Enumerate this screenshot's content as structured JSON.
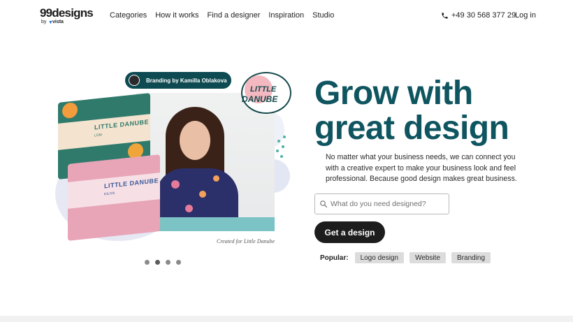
{
  "header": {
    "logo_text": "99designs",
    "logo_by": "by",
    "logo_vista": "vista",
    "nav": [
      "Categories",
      "How it works",
      "Find a designer",
      "Inspiration",
      "Studio"
    ],
    "phone": "+49 30 568 377 29",
    "login": "Log in"
  },
  "hero_visual": {
    "badge_text": "Branding by Kamilla Oblakova",
    "brand_line1": "LITTLE",
    "brand_line2": "DANUBE",
    "box_top_label": "LITTLE DANUBE",
    "box_top_sub": "LOM",
    "box_bottom_label": "LITTLE DANUBE",
    "box_bottom_sub": "KILIYA",
    "caption": "Created for Little Danube",
    "carousel": {
      "count": 4,
      "active_index": 1
    }
  },
  "hero": {
    "headline_line1": "Grow with",
    "headline_line2": "great design",
    "lead": "No matter what your business needs, we can connect you with a creative expert to make your business look and feel professional. Because good design makes great business.",
    "search_placeholder": "What do you need designed?",
    "cta_label": "Get a design",
    "popular_label": "Popular:",
    "popular_items": [
      "Logo design",
      "Website",
      "Branding"
    ]
  },
  "colors": {
    "headline": "#0f5560",
    "cta_bg": "#1d1d1d",
    "badge_bg": "#0d4a52",
    "chip_bg": "#dcdcdc"
  }
}
